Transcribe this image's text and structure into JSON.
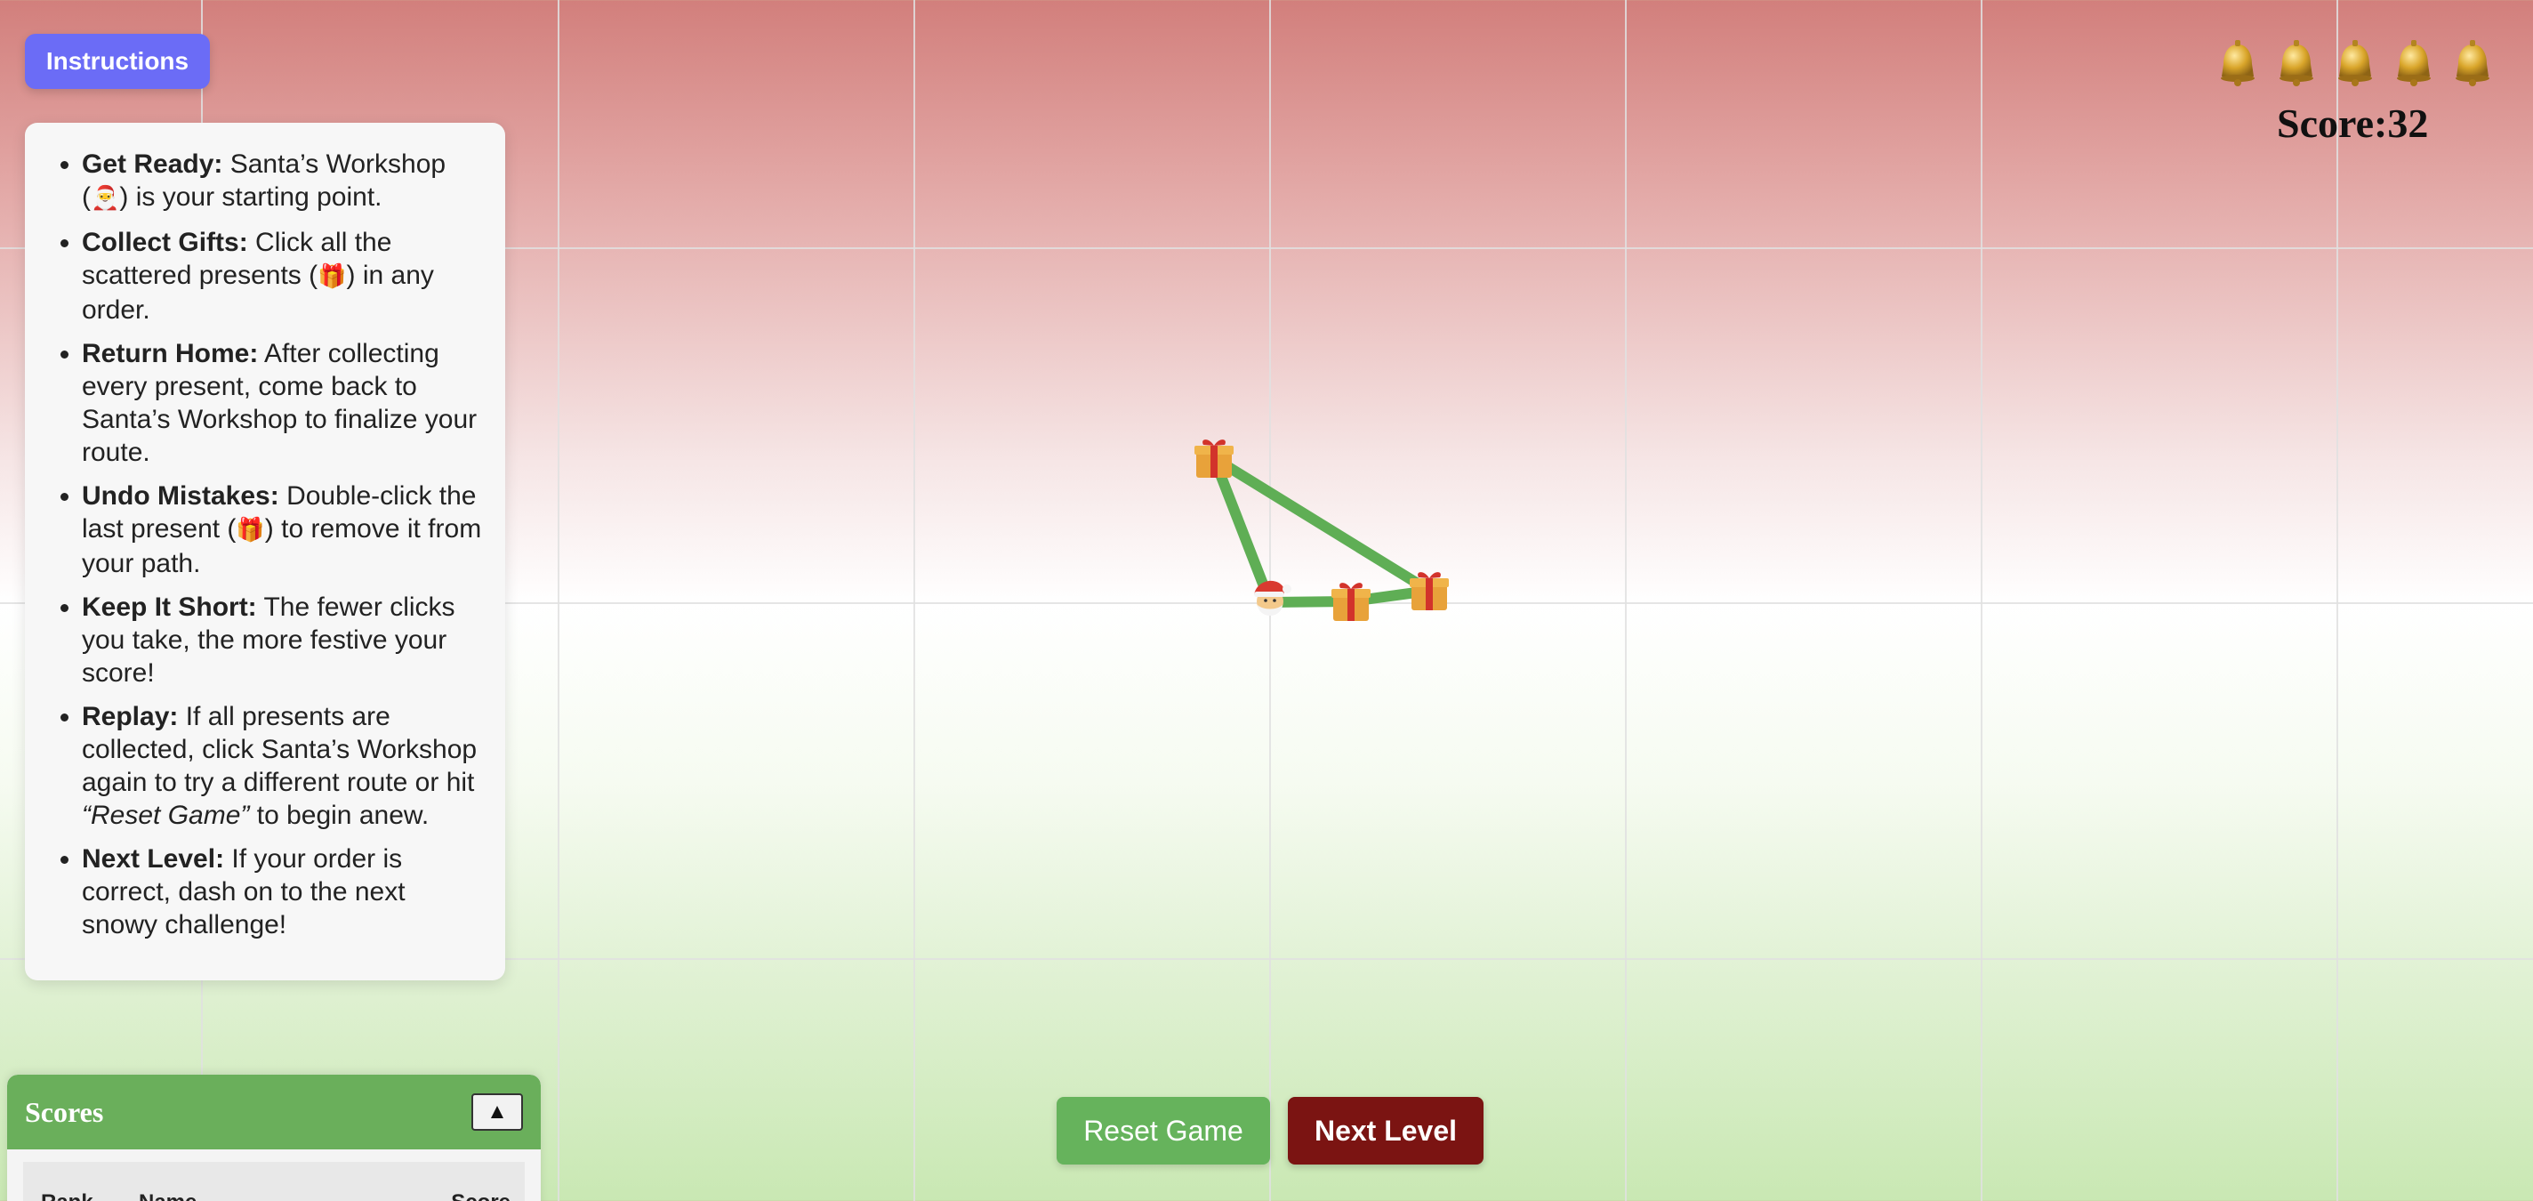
{
  "instructions_button": {
    "label": "Instructions"
  },
  "instructions": [
    {
      "title": "Get Ready:",
      "text_parts": [
        "Santa’s Workshop (",
        ") is your starting point."
      ],
      "icon": "santa-icon"
    },
    {
      "title": "Collect Gifts:",
      "text_parts": [
        "Click all the scattered presents (",
        ") in any order."
      ],
      "icon": "gift-icon"
    },
    {
      "title": "Return Home:",
      "text": "After collecting every present, come back to Santa’s Workshop to finalize your route."
    },
    {
      "title": "Undo Mistakes:",
      "text_parts": [
        "Double-click the last present (",
        ") to remove it from your path."
      ],
      "icon": "gift-icon"
    },
    {
      "title": "Keep It Short:",
      "text": "The fewer clicks you take, the more festive your score!"
    },
    {
      "title": "Replay:",
      "text": "If all presents are collected, click Santa’s Workshop again to try a different route or hit",
      "italic": "“Reset Game”",
      "text_after": "to begin anew."
    },
    {
      "title": "Next Level:",
      "text": "If your order is correct, dash on to the next snowy challenge!"
    }
  ],
  "bells": {
    "count": 5,
    "icon": "bell-icon"
  },
  "score": {
    "label": "Score:",
    "value": "32"
  },
  "buttons": {
    "reset": "Reset Game",
    "next": "Next Level"
  },
  "scores_panel": {
    "title": "Scores",
    "toggle": "▲",
    "columns": [
      "Rank",
      "Name",
      "Score"
    ]
  },
  "colors": {
    "path": "#5fae55",
    "instructions_button": "#6b6cf6",
    "reset_button": "#66b35c",
    "next_button": "#7b1412",
    "scores_header": "#6aaf5b"
  }
}
